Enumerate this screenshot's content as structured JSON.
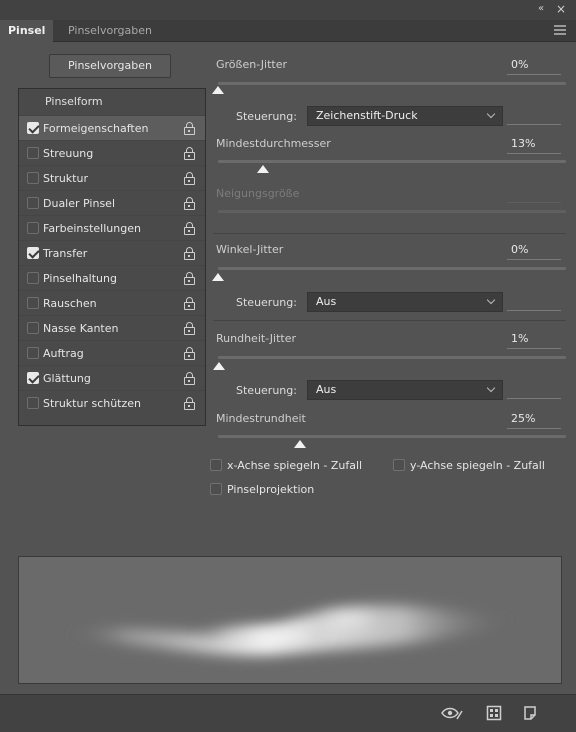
{
  "titlebar": {
    "collapse_icon": "«",
    "close_icon": "×"
  },
  "tabs": [
    {
      "label": "Pinsel"
    },
    {
      "label": "Pinselvorgaben"
    }
  ],
  "preset_button": "Pinselvorgaben",
  "left_panel": {
    "heading": "Pinselform",
    "items": [
      {
        "label": "Formeigenschaften",
        "checked": true,
        "selected": true
      },
      {
        "label": "Streuung",
        "checked": false
      },
      {
        "label": "Struktur",
        "checked": false
      },
      {
        "label": "Dualer Pinsel",
        "checked": false
      },
      {
        "label": "Farbeinstellungen",
        "checked": false
      },
      {
        "label": "Transfer",
        "checked": true
      },
      {
        "label": "Pinselhaltung",
        "checked": false
      },
      {
        "label": "Rauschen",
        "checked": false
      },
      {
        "label": "Nasse Kanten",
        "checked": false
      },
      {
        "label": "Auftrag",
        "checked": false
      },
      {
        "label": "Glättung",
        "checked": true
      },
      {
        "label": "Struktur schützen",
        "checked": false
      }
    ]
  },
  "settings": {
    "size_jitter": {
      "label": "Größen-Jitter",
      "value": "0%",
      "level": 0
    },
    "size_control": {
      "label": "Steuerung:",
      "value": "Zeichenstift-Druck"
    },
    "min_diameter": {
      "label": "Mindestdurchmesser",
      "value": "13%",
      "level": 13
    },
    "tilt_scale": {
      "label": "Neigungsgröße"
    },
    "angle_jitter": {
      "label": "Winkel-Jitter",
      "value": "0%",
      "level": 0
    },
    "angle_control": {
      "label": "Steuerung:",
      "value": "Aus"
    },
    "roundness_jitter": {
      "label": "Rundheit-Jitter",
      "value": "1%",
      "level": 1
    },
    "roundness_control": {
      "label": "Steuerung:",
      "value": "Aus"
    },
    "min_roundness": {
      "label": "Mindestrundheit",
      "value": "25%",
      "level": 25
    }
  },
  "checkboxes": {
    "flip_x": "x-Achse spiegeln - Zufall",
    "flip_y": "y-Achse spiegeln - Zufall",
    "projection": "Pinselprojektion"
  },
  "bottom_icons": [
    "eye-brush-icon",
    "grid-panel-icon",
    "new-page-icon"
  ]
}
